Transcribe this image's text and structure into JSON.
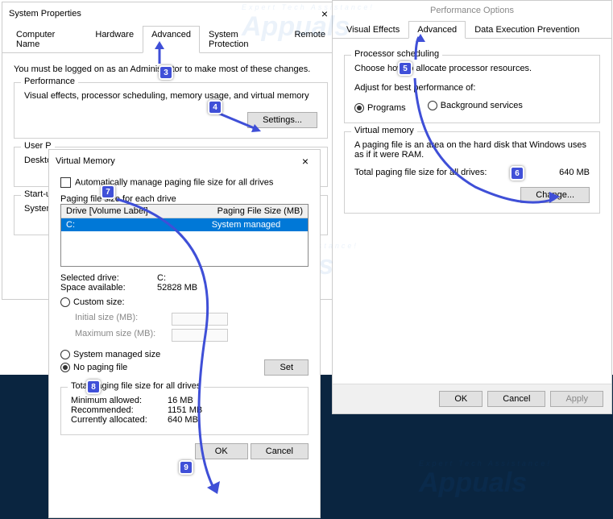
{
  "sysprops": {
    "title": "System Properties",
    "tabs": [
      "Computer Name",
      "Hardware",
      "Advanced",
      "System Protection",
      "Remote"
    ],
    "note": "You must be logged on as an Administrator to make most of these changes.",
    "perf": {
      "title": "Performance",
      "desc": "Visual effects, processor scheduling, memory usage, and virtual memory",
      "btn": "Settings..."
    },
    "userp": {
      "title": "User P",
      "desc": "Desktop"
    },
    "startup": {
      "title": "Start-up",
      "desc": "System"
    }
  },
  "perfopt": {
    "title": "Performance Options",
    "tabs": [
      "Visual Effects",
      "Advanced",
      "Data Execution Prevention"
    ],
    "sched": {
      "title": "Processor scheduling",
      "l1": "Choose how to allocate processor resources.",
      "l2": "Adjust for best performance of:",
      "r1": "Programs",
      "r2": "Background services"
    },
    "vm": {
      "title": "Virtual memory",
      "l1": "A paging file is an area on the hard disk that Windows uses as if it were RAM.",
      "l2": "Total paging file size for all drives:",
      "val": "640 MB",
      "btn": "Change..."
    },
    "ok": "OK",
    "cancel": "Cancel",
    "apply": "Apply"
  },
  "vmdlg": {
    "title": "Virtual Memory",
    "auto": "Automatically manage paging file size for all drives",
    "pgsz": "Paging file size for each drive",
    "h1": "Drive  [Volume Label]",
    "h2": "Paging File Size (MB)",
    "drive": "C:",
    "mode": "System managed",
    "seldrv": "Selected drive:",
    "seldrvv": "C:",
    "space": "Space available:",
    "spacev": "52828 MB",
    "custom": "Custom size:",
    "init": "Initial size (MB):",
    "max": "Maximum size (MB):",
    "sysman": "System managed size",
    "nopg": "No paging file",
    "set": "Set",
    "tot": "Total paging file size for all drives",
    "min": "Minimum allowed:",
    "minv": "16 MB",
    "rec": "Recommended:",
    "recv": "1151 MB",
    "cur": "Currently allocated:",
    "curv": "640 MB",
    "ok": "OK",
    "cancel": "Cancel"
  },
  "watermark": {
    "brand": "Appuals",
    "tag": "Expert Tech Assistance!"
  }
}
